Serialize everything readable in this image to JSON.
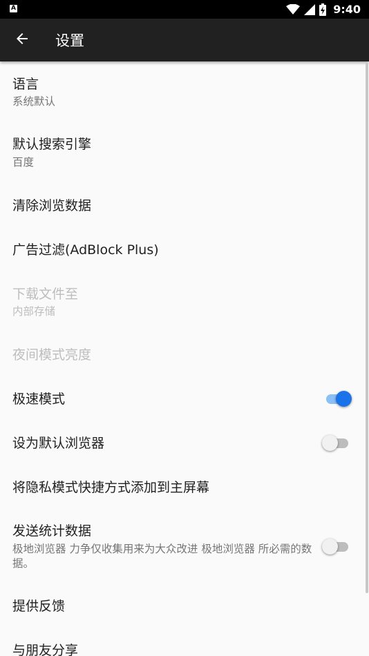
{
  "status_bar": {
    "time": "9:40",
    "app_icon_label": "A"
  },
  "toolbar": {
    "title": "设置"
  },
  "settings": [
    {
      "title": "语言",
      "subtitle": "系统默认"
    },
    {
      "title": "默认搜索引擎",
      "subtitle": "百度"
    },
    {
      "title": "清除浏览数据"
    },
    {
      "title": "广告过滤(AdBlock Plus)"
    },
    {
      "title": "下载文件至",
      "subtitle": "内部存储",
      "enabled": false
    },
    {
      "title": "夜间模式亮度",
      "enabled": false
    },
    {
      "title": "极速模式",
      "switch": "on"
    },
    {
      "title": "设为默认浏览器",
      "switch": "off"
    },
    {
      "title": "将隐私模式快捷方式添加到主屏幕"
    },
    {
      "title": "发送统计数据",
      "subtitle": "极地浏览器 力争仅收集用来为大众改进 极地浏览器 所必需的数据。",
      "switch": "off"
    },
    {
      "title": "提供反馈"
    },
    {
      "title": "与朋友分享"
    }
  ],
  "colors": {
    "accent": "#1a73e8",
    "toolbar": "#212121",
    "background": "#fafafa"
  }
}
